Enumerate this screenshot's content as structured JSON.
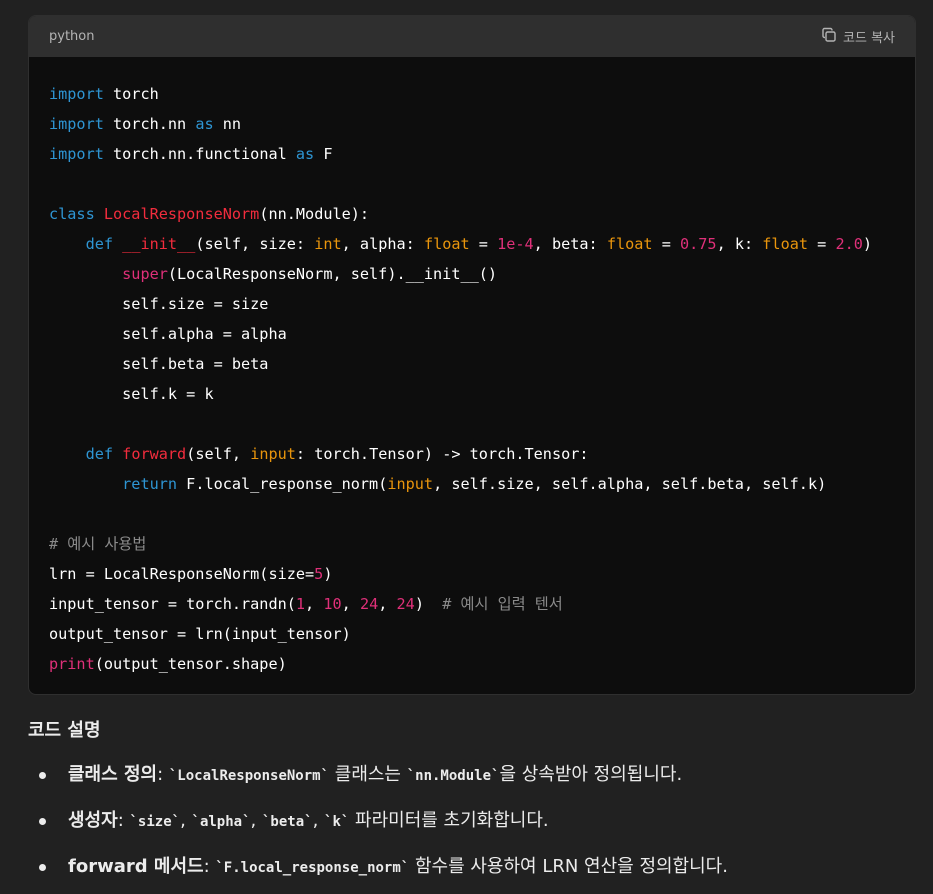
{
  "code_block": {
    "language": "python",
    "copy_label": "코드 복사",
    "lines": [
      [
        {
          "t": "import",
          "c": "kw"
        },
        {
          "t": " torch",
          "c": ""
        }
      ],
      [
        {
          "t": "import",
          "c": "kw"
        },
        {
          "t": " torch.nn ",
          "c": ""
        },
        {
          "t": "as",
          "c": "kw"
        },
        {
          "t": " nn",
          "c": ""
        }
      ],
      [
        {
          "t": "import",
          "c": "kw"
        },
        {
          "t": " torch.nn.functional ",
          "c": ""
        },
        {
          "t": "as",
          "c": "kw"
        },
        {
          "t": " F",
          "c": ""
        }
      ],
      [],
      [
        {
          "t": "class",
          "c": "kw"
        },
        {
          "t": " ",
          "c": ""
        },
        {
          "t": "LocalResponseNorm",
          "c": "cls"
        },
        {
          "t": "(nn.Module):",
          "c": ""
        }
      ],
      [
        {
          "t": "    ",
          "c": ""
        },
        {
          "t": "def",
          "c": "kw"
        },
        {
          "t": " ",
          "c": ""
        },
        {
          "t": "__init__",
          "c": "dunder"
        },
        {
          "t": "(self, size: ",
          "c": ""
        },
        {
          "t": "int",
          "c": "ty"
        },
        {
          "t": ", alpha: ",
          "c": ""
        },
        {
          "t": "float",
          "c": "ty"
        },
        {
          "t": " = ",
          "c": ""
        },
        {
          "t": "1e-4",
          "c": "num"
        },
        {
          "t": ", beta: ",
          "c": ""
        },
        {
          "t": "float",
          "c": "ty"
        },
        {
          "t": " = ",
          "c": ""
        },
        {
          "t": "0.75",
          "c": "num"
        },
        {
          "t": ", k: ",
          "c": ""
        },
        {
          "t": "float",
          "c": "ty"
        },
        {
          "t": " = ",
          "c": ""
        },
        {
          "t": "2.0",
          "c": "num"
        },
        {
          "t": ")",
          "c": ""
        }
      ],
      [
        {
          "t": "        ",
          "c": ""
        },
        {
          "t": "super",
          "c": "bi"
        },
        {
          "t": "(LocalResponseNorm, self).__init__()",
          "c": ""
        }
      ],
      [
        {
          "t": "        self.size = size",
          "c": ""
        }
      ],
      [
        {
          "t": "        self.alpha = alpha",
          "c": ""
        }
      ],
      [
        {
          "t": "        self.beta = beta",
          "c": ""
        }
      ],
      [
        {
          "t": "        self.k = k",
          "c": ""
        }
      ],
      [],
      [
        {
          "t": "    ",
          "c": ""
        },
        {
          "t": "def",
          "c": "kw"
        },
        {
          "t": " ",
          "c": ""
        },
        {
          "t": "forward",
          "c": "fn"
        },
        {
          "t": "(self, ",
          "c": ""
        },
        {
          "t": "input",
          "c": "prm"
        },
        {
          "t": ": torch.Tensor) -> torch.Tensor:",
          "c": ""
        }
      ],
      [
        {
          "t": "        ",
          "c": ""
        },
        {
          "t": "return",
          "c": "kw"
        },
        {
          "t": " F.local_response_norm(",
          "c": ""
        },
        {
          "t": "input",
          "c": "prm"
        },
        {
          "t": ", self.size, self.alpha, self.beta, self.k)",
          "c": ""
        }
      ],
      [],
      [
        {
          "t": "# 예시 사용법",
          "c": "cm"
        }
      ],
      [
        {
          "t": "lrn = LocalResponseNorm(size=",
          "c": ""
        },
        {
          "t": "5",
          "c": "num"
        },
        {
          "t": ")",
          "c": ""
        }
      ],
      [
        {
          "t": "input_tensor = torch.randn(",
          "c": ""
        },
        {
          "t": "1",
          "c": "num"
        },
        {
          "t": ", ",
          "c": ""
        },
        {
          "t": "10",
          "c": "num"
        },
        {
          "t": ", ",
          "c": ""
        },
        {
          "t": "24",
          "c": "num"
        },
        {
          "t": ", ",
          "c": ""
        },
        {
          "t": "24",
          "c": "num"
        },
        {
          "t": ")  ",
          "c": ""
        },
        {
          "t": "# 예시 입력 텐서",
          "c": "cm"
        }
      ],
      [
        {
          "t": "output_tensor = lrn(input_tensor)",
          "c": ""
        }
      ],
      [
        {
          "t": "print",
          "c": "bi"
        },
        {
          "t": "(output_tensor.shape)",
          "c": ""
        }
      ]
    ]
  },
  "explanation": {
    "title": "코드 설명",
    "items": [
      {
        "term": "클래스 정의",
        "sep": ": ",
        "parts": [
          {
            "code": "`LocalResponseNorm`"
          },
          {
            "text": " 클래스는 "
          },
          {
            "code": "`nn.Module`"
          },
          {
            "text": "을 상속받아 정의됩니다."
          }
        ]
      },
      {
        "term": "생성자",
        "sep": ": ",
        "parts": [
          {
            "code": "`size`"
          },
          {
            "text": ", "
          },
          {
            "code": "`alpha`"
          },
          {
            "text": ", "
          },
          {
            "code": "`beta`"
          },
          {
            "text": ", "
          },
          {
            "code": "`k`"
          },
          {
            "text": " 파라미터를 초기화합니다."
          }
        ]
      },
      {
        "term": "forward 메서드",
        "sep": ": ",
        "parts": [
          {
            "code": "`F.local_response_norm`"
          },
          {
            "text": " 함수를 사용하여 LRN 연산을 정의합니다."
          }
        ]
      }
    ]
  }
}
